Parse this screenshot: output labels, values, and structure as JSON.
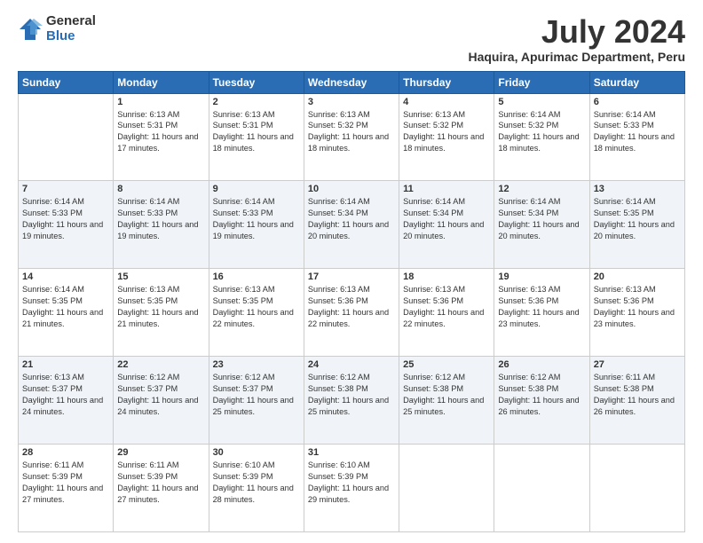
{
  "logo": {
    "general": "General",
    "blue": "Blue"
  },
  "header": {
    "month": "July 2024",
    "location": "Haquira, Apurimac Department, Peru"
  },
  "days": [
    "Sunday",
    "Monday",
    "Tuesday",
    "Wednesday",
    "Thursday",
    "Friday",
    "Saturday"
  ],
  "weeks": [
    [
      {
        "day": "",
        "sunrise": "",
        "sunset": "",
        "daylight": ""
      },
      {
        "day": "1",
        "sunrise": "Sunrise: 6:13 AM",
        "sunset": "Sunset: 5:31 PM",
        "daylight": "Daylight: 11 hours and 17 minutes."
      },
      {
        "day": "2",
        "sunrise": "Sunrise: 6:13 AM",
        "sunset": "Sunset: 5:31 PM",
        "daylight": "Daylight: 11 hours and 18 minutes."
      },
      {
        "day": "3",
        "sunrise": "Sunrise: 6:13 AM",
        "sunset": "Sunset: 5:32 PM",
        "daylight": "Daylight: 11 hours and 18 minutes."
      },
      {
        "day": "4",
        "sunrise": "Sunrise: 6:13 AM",
        "sunset": "Sunset: 5:32 PM",
        "daylight": "Daylight: 11 hours and 18 minutes."
      },
      {
        "day": "5",
        "sunrise": "Sunrise: 6:14 AM",
        "sunset": "Sunset: 5:32 PM",
        "daylight": "Daylight: 11 hours and 18 minutes."
      },
      {
        "day": "6",
        "sunrise": "Sunrise: 6:14 AM",
        "sunset": "Sunset: 5:33 PM",
        "daylight": "Daylight: 11 hours and 18 minutes."
      }
    ],
    [
      {
        "day": "7",
        "sunrise": "Sunrise: 6:14 AM",
        "sunset": "Sunset: 5:33 PM",
        "daylight": "Daylight: 11 hours and 19 minutes."
      },
      {
        "day": "8",
        "sunrise": "Sunrise: 6:14 AM",
        "sunset": "Sunset: 5:33 PM",
        "daylight": "Daylight: 11 hours and 19 minutes."
      },
      {
        "day": "9",
        "sunrise": "Sunrise: 6:14 AM",
        "sunset": "Sunset: 5:33 PM",
        "daylight": "Daylight: 11 hours and 19 minutes."
      },
      {
        "day": "10",
        "sunrise": "Sunrise: 6:14 AM",
        "sunset": "Sunset: 5:34 PM",
        "daylight": "Daylight: 11 hours and 20 minutes."
      },
      {
        "day": "11",
        "sunrise": "Sunrise: 6:14 AM",
        "sunset": "Sunset: 5:34 PM",
        "daylight": "Daylight: 11 hours and 20 minutes."
      },
      {
        "day": "12",
        "sunrise": "Sunrise: 6:14 AM",
        "sunset": "Sunset: 5:34 PM",
        "daylight": "Daylight: 11 hours and 20 minutes."
      },
      {
        "day": "13",
        "sunrise": "Sunrise: 6:14 AM",
        "sunset": "Sunset: 5:35 PM",
        "daylight": "Daylight: 11 hours and 20 minutes."
      }
    ],
    [
      {
        "day": "14",
        "sunrise": "Sunrise: 6:14 AM",
        "sunset": "Sunset: 5:35 PM",
        "daylight": "Daylight: 11 hours and 21 minutes."
      },
      {
        "day": "15",
        "sunrise": "Sunrise: 6:13 AM",
        "sunset": "Sunset: 5:35 PM",
        "daylight": "Daylight: 11 hours and 21 minutes."
      },
      {
        "day": "16",
        "sunrise": "Sunrise: 6:13 AM",
        "sunset": "Sunset: 5:35 PM",
        "daylight": "Daylight: 11 hours and 22 minutes."
      },
      {
        "day": "17",
        "sunrise": "Sunrise: 6:13 AM",
        "sunset": "Sunset: 5:36 PM",
        "daylight": "Daylight: 11 hours and 22 minutes."
      },
      {
        "day": "18",
        "sunrise": "Sunrise: 6:13 AM",
        "sunset": "Sunset: 5:36 PM",
        "daylight": "Daylight: 11 hours and 22 minutes."
      },
      {
        "day": "19",
        "sunrise": "Sunrise: 6:13 AM",
        "sunset": "Sunset: 5:36 PM",
        "daylight": "Daylight: 11 hours and 23 minutes."
      },
      {
        "day": "20",
        "sunrise": "Sunrise: 6:13 AM",
        "sunset": "Sunset: 5:36 PM",
        "daylight": "Daylight: 11 hours and 23 minutes."
      }
    ],
    [
      {
        "day": "21",
        "sunrise": "Sunrise: 6:13 AM",
        "sunset": "Sunset: 5:37 PM",
        "daylight": "Daylight: 11 hours and 24 minutes."
      },
      {
        "day": "22",
        "sunrise": "Sunrise: 6:12 AM",
        "sunset": "Sunset: 5:37 PM",
        "daylight": "Daylight: 11 hours and 24 minutes."
      },
      {
        "day": "23",
        "sunrise": "Sunrise: 6:12 AM",
        "sunset": "Sunset: 5:37 PM",
        "daylight": "Daylight: 11 hours and 25 minutes."
      },
      {
        "day": "24",
        "sunrise": "Sunrise: 6:12 AM",
        "sunset": "Sunset: 5:38 PM",
        "daylight": "Daylight: 11 hours and 25 minutes."
      },
      {
        "day": "25",
        "sunrise": "Sunrise: 6:12 AM",
        "sunset": "Sunset: 5:38 PM",
        "daylight": "Daylight: 11 hours and 25 minutes."
      },
      {
        "day": "26",
        "sunrise": "Sunrise: 6:12 AM",
        "sunset": "Sunset: 5:38 PM",
        "daylight": "Daylight: 11 hours and 26 minutes."
      },
      {
        "day": "27",
        "sunrise": "Sunrise: 6:11 AM",
        "sunset": "Sunset: 5:38 PM",
        "daylight": "Daylight: 11 hours and 26 minutes."
      }
    ],
    [
      {
        "day": "28",
        "sunrise": "Sunrise: 6:11 AM",
        "sunset": "Sunset: 5:39 PM",
        "daylight": "Daylight: 11 hours and 27 minutes."
      },
      {
        "day": "29",
        "sunrise": "Sunrise: 6:11 AM",
        "sunset": "Sunset: 5:39 PM",
        "daylight": "Daylight: 11 hours and 27 minutes."
      },
      {
        "day": "30",
        "sunrise": "Sunrise: 6:10 AM",
        "sunset": "Sunset: 5:39 PM",
        "daylight": "Daylight: 11 hours and 28 minutes."
      },
      {
        "day": "31",
        "sunrise": "Sunrise: 6:10 AM",
        "sunset": "Sunset: 5:39 PM",
        "daylight": "Daylight: 11 hours and 29 minutes."
      },
      {
        "day": "",
        "sunrise": "",
        "sunset": "",
        "daylight": ""
      },
      {
        "day": "",
        "sunrise": "",
        "sunset": "",
        "daylight": ""
      },
      {
        "day": "",
        "sunrise": "",
        "sunset": "",
        "daylight": ""
      }
    ]
  ]
}
